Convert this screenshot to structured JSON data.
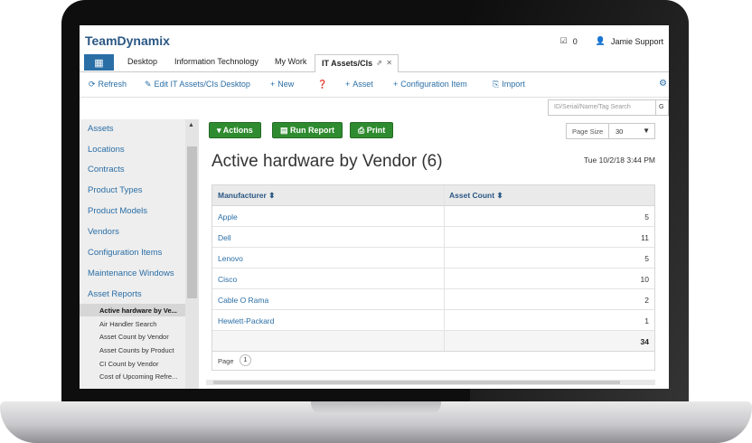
{
  "app": {
    "brand": "TeamDynamix",
    "notification_count": "0",
    "user_name": "Jamie Support"
  },
  "tabs": [
    {
      "label": "Desktop"
    },
    {
      "label": "Information Technology"
    },
    {
      "label": "My Work"
    },
    {
      "label": "IT Assets/CIs",
      "active": true
    }
  ],
  "toolbar": {
    "refresh": "Refresh",
    "edit_desktop": "Edit IT Assets/CIs Desktop",
    "new": "New",
    "asset": "Asset",
    "configuration_item": "Configuration Item",
    "import": "Import"
  },
  "search": {
    "placeholder": "ID/Serial/Name/Tag Search",
    "button": "G"
  },
  "sidebar": {
    "items": [
      "Assets",
      "Locations",
      "Contracts",
      "Product Types",
      "Product Models",
      "Vendors",
      "Configuration Items",
      "Maintenance Windows",
      "Asset Reports"
    ],
    "reports": [
      "Active hardware by Ve...",
      "Air Handler Search",
      "Asset Count by Vendor",
      "Asset Counts by Product",
      "CI Count by Vendor",
      "Cost of Upcoming Refre..."
    ]
  },
  "actions": {
    "actions": "Actions",
    "run_report": "Run Report",
    "print": "Print",
    "page_size_label": "Page Size",
    "page_size_value": "30"
  },
  "report": {
    "title": "Active hardware by Vendor (6)",
    "date": "Tue 10/2/18 3:44 PM",
    "col_manufacturer": "Manufacturer",
    "col_asset_count": "Asset Count",
    "rows": [
      {
        "name": "Apple",
        "count": "5"
      },
      {
        "name": "Dell",
        "count": "11"
      },
      {
        "name": "Lenovo",
        "count": "5"
      },
      {
        "name": "Cisco",
        "count": "10"
      },
      {
        "name": "Cable O Rama",
        "count": "2"
      },
      {
        "name": "Hewlett-Packard",
        "count": "1"
      }
    ],
    "total": "34",
    "page_label": "Page",
    "page_number": "1"
  }
}
